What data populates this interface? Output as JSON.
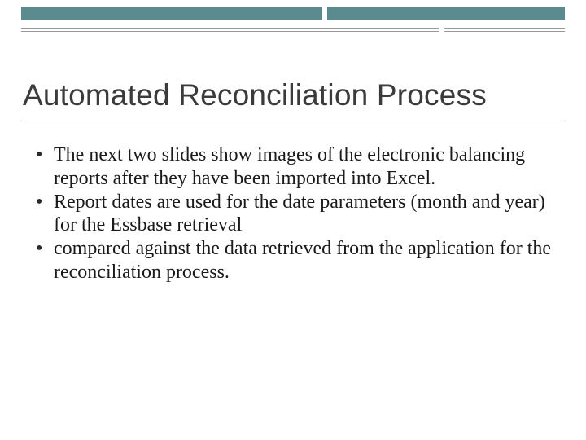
{
  "title": "Automated Reconciliation Process",
  "bullets": [
    "The next two slides show images of the electronic balancing reports after they have been imported into Excel.",
    "Report dates are used for the date parameters (month and year) for the Essbase retrieval",
    "compared against the data retrieved from the application for the reconciliation process."
  ]
}
